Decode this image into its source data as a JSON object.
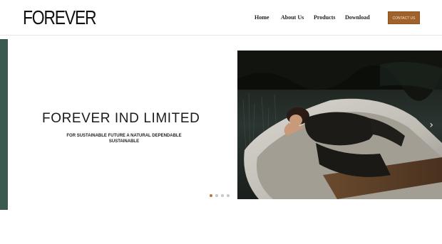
{
  "header": {
    "logo_text": "FOREVER",
    "nav": [
      {
        "label": "Home"
      },
      {
        "label": "About Us"
      },
      {
        "label": "Products"
      },
      {
        "label": "Download"
      }
    ],
    "contact_label": "contact us"
  },
  "hero": {
    "title": "FOREVER IND LIMITED",
    "subtitle": "FOR SUSTAINABLE FUTURE A NATURAL DEPENDABLE SUSTAINABLE",
    "slide_count": 4,
    "active_slide": 1,
    "next_arrow_icon": "chevron-right-icon"
  },
  "colors": {
    "accent": "#a0622a",
    "side_bar": "#3a5a4f",
    "active_dot": "#b4773f",
    "inactive_dot": "#c7c7c7"
  }
}
